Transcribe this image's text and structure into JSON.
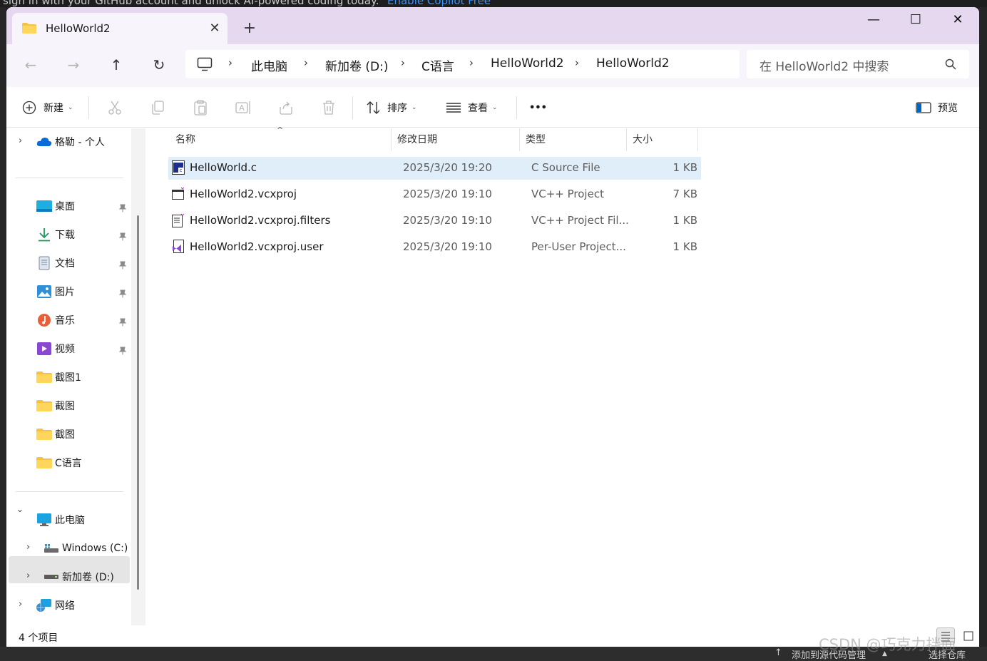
{
  "background": {
    "top_text": "sign in with your GitHub account and unlock AI-powered coding today.",
    "top_link": "Enable Copilot Free",
    "status_left": "添加到源代码管理",
    "status_right": "选择仓库"
  },
  "window": {
    "tab_title": "HelloWorld2",
    "tab_close": "✕",
    "tab_add": "+",
    "minimize": "—",
    "maximize": "☐",
    "close": "✕"
  },
  "nav": {
    "back": "←",
    "forward": "→",
    "up": "↑",
    "refresh": "↻",
    "breadcrumbs": [
      "此电脑",
      "新加卷 (D:)",
      "C语言",
      "HelloWorld2",
      "HelloWorld2"
    ],
    "search_placeholder": "在 HelloWorld2 中搜索"
  },
  "toolbar": {
    "new_label": "新建",
    "sort_label": "排序",
    "view_label": "查看",
    "more_label": "•••",
    "preview_label": "预览"
  },
  "sidebar": {
    "cloud": "格勒 - 个人",
    "quick": [
      {
        "label": "桌面",
        "icon": "desktop-icon"
      },
      {
        "label": "下载",
        "icon": "download-icon"
      },
      {
        "label": "文档",
        "icon": "document-icon"
      },
      {
        "label": "图片",
        "icon": "pictures-icon"
      },
      {
        "label": "音乐",
        "icon": "music-icon"
      },
      {
        "label": "视频",
        "icon": "video-icon"
      },
      {
        "label": "截图1",
        "icon": "folder-icon"
      },
      {
        "label": "截图",
        "icon": "folder-icon"
      },
      {
        "label": "截图",
        "icon": "folder-icon"
      },
      {
        "label": "C语言",
        "icon": "folder-icon"
      }
    ],
    "this_pc": "此电脑",
    "drive_c": "Windows (C:)",
    "drive_d": "新加卷 (D:)",
    "network": "网络"
  },
  "columns": {
    "name": "名称",
    "date": "修改日期",
    "type": "类型",
    "size": "大小"
  },
  "files": [
    {
      "name": "HelloWorld.c",
      "date": "2025/3/20 19:20",
      "type": "C Source File",
      "size": "1 KB"
    },
    {
      "name": "HelloWorld2.vcxproj",
      "date": "2025/3/20 19:10",
      "type": "VC++ Project",
      "size": "7 KB"
    },
    {
      "name": "HelloWorld2.vcxproj.filters",
      "date": "2025/3/20 19:10",
      "type": "VC++ Project Fil...",
      "size": "1 KB"
    },
    {
      "name": "HelloWorld2.vcxproj.user",
      "date": "2025/3/20 19:10",
      "type": "Per-User Project...",
      "size": "1 KB"
    }
  ],
  "status": {
    "count": "4 个项目"
  },
  "watermark": "CSDN @巧克力拌面",
  "colors": {
    "titlebar": "#e6d9ef",
    "navbar": "#f8f4fb",
    "selection": "#e0eef9",
    "folder": "#f4c244",
    "accent": "#0067c0"
  }
}
